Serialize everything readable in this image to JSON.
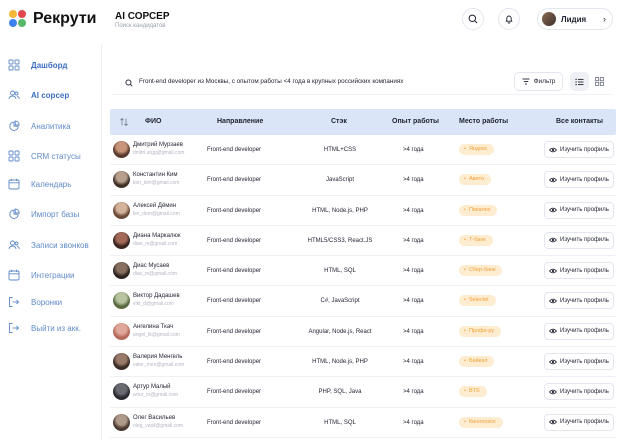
{
  "header": {
    "logo_text": "Рекрути",
    "page_title": "AI СОРСЕР",
    "page_subtitle": "Поиск кандидатов",
    "user_name": "Лидия"
  },
  "sidebar": {
    "items": [
      {
        "label": "Дашборд",
        "icon": "dashboard-icon",
        "active": true
      },
      {
        "label": "AI сорсер",
        "icon": "users-icon",
        "active": true
      },
      {
        "label": "Аналитика",
        "icon": "pie-chart-icon",
        "active": false
      },
      {
        "label": "CRM статусы",
        "icon": "grid-icon",
        "active": false
      },
      {
        "label": "Календарь",
        "icon": "calendar-icon",
        "active": false
      },
      {
        "label": "Импорт базы",
        "icon": "import-icon",
        "active": false
      },
      {
        "label": "Записи звонков",
        "icon": "calls-icon",
        "active": false
      },
      {
        "label": "Интеграции",
        "icon": "integrations-icon",
        "active": false
      },
      {
        "label": "Воронки",
        "icon": "funnel-icon",
        "active": false
      },
      {
        "label": "Выйти из акк.",
        "icon": "logout-icon",
        "active": false
      }
    ]
  },
  "search": {
    "query": "Front-end developer из Москвы, с опытом работы <4 года в крупных российских компаниях",
    "filter_label": "Фильтр"
  },
  "table": {
    "columns": {
      "name": "ФИО",
      "direction": "Направление",
      "stack": "Стэк",
      "experience": "Опыт работы",
      "workplace": "Место работы",
      "contacts": "Все контакты"
    },
    "profile_button_label": "Изучить профиль",
    "rows": [
      {
        "name": "Дмитрий Мурзаев",
        "email": "dmitri.urgg@gmail.com",
        "direction": "Front-end developer",
        "stack": "HTML+CSS",
        "experience": ">4 года",
        "workplace": "Яндекс"
      },
      {
        "name": "Константин Ким",
        "email": "kon_kim@gmail.com",
        "direction": "Front-end developer",
        "stack": "JavaScript",
        "experience": ">4 года",
        "workplace": "Авито"
      },
      {
        "name": "Алексей Дёмин",
        "email": "lex_dem@gmail.com",
        "direction": "Front-end developer",
        "stack": "HTML, Node.js, PHP",
        "experience": ">4 года",
        "workplace": "Пикалех"
      },
      {
        "name": "Диана Маркалюк",
        "email": "dian_m@gmail.com",
        "direction": "Front-end developer",
        "stack": "HTML5/CSS3, React.JS",
        "experience": ">4 года",
        "workplace": "Т-банк"
      },
      {
        "name": "Диас Мусаев",
        "email": "dias_m@gmail.com",
        "direction": "Front-end developer",
        "stack": "HTML, SQL",
        "experience": ">4 года",
        "workplace": "Сбер-банк"
      },
      {
        "name": "Виктор Дадашев",
        "email": "vikt_d@gmail.com",
        "direction": "Front-end developer",
        "stack": "C#, JavaScript",
        "experience": ">4 года",
        "workplace": "Selectel"
      },
      {
        "name": "Ангелина Ткач",
        "email": "angel_tk@gmail.com",
        "direction": "Front-end developer",
        "stack": "Angular, Node.js, React",
        "experience": ">4 года",
        "workplace": "Профи-ру"
      },
      {
        "name": "Валерия Менгель",
        "email": "valer_men@gmail.com",
        "direction": "Front-end developer",
        "stack": "HTML, Node.js, PHP",
        "experience": ">4 года",
        "workplace": "Байкал"
      },
      {
        "name": "Артур Малый",
        "email": "artur_m@gmail.com",
        "direction": "Front-end developer",
        "stack": "PHP, SQL, Java",
        "experience": ">4 года",
        "workplace": "BTS"
      },
      {
        "name": "Олег Васильев",
        "email": "oleg_vasil@gmail.com",
        "direction": "Front-end developer",
        "stack": "HTML, SQL",
        "experience": ">4 года",
        "workplace": "Кинопоиск"
      }
    ]
  }
}
